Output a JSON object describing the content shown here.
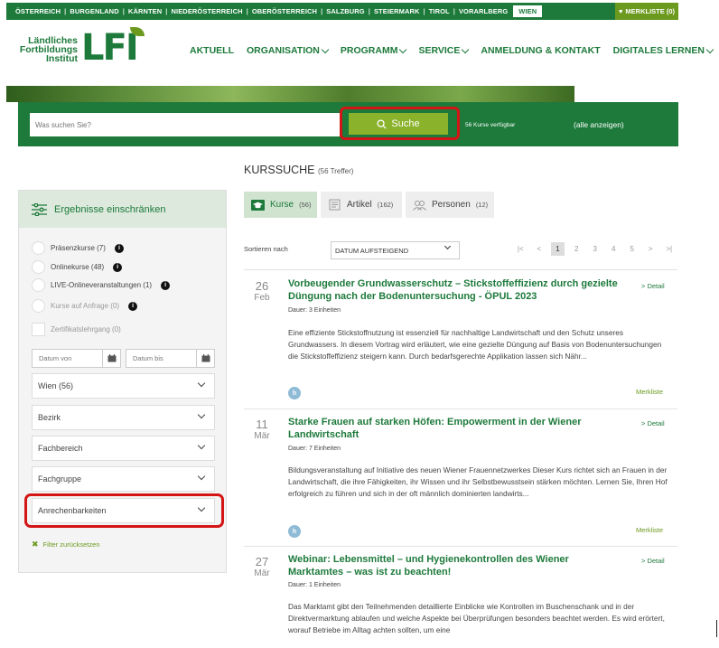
{
  "topbar": {
    "regions": [
      "ÖSTERREICH",
      "BURGENLAND",
      "KÄRNTEN",
      "NIEDERÖSTERREICH",
      "OBERÖSTERREICH",
      "SALZBURG",
      "STEIERMARK",
      "TIROL",
      "VORARLBERG"
    ],
    "active_region": "WIEN",
    "merkliste": "MERKLISTE (0)"
  },
  "logo": {
    "line1": "Ländliches",
    "line2": "Fortbildungs",
    "line3": "Institut",
    "mark": "LFI"
  },
  "nav": {
    "aktuell": "AKTUELL",
    "organisation": "ORGANISATION",
    "programm": "PROGRAMM",
    "service": "SERVICE",
    "anmeldung": "ANMELDUNG & KONTAKT",
    "digitales": "DIGITALES LERNEN"
  },
  "search": {
    "placeholder": "Was suchen Sie?",
    "button": "Suche",
    "count": "56 Kurse verfügbar",
    "show_all": "(alle anzeigen)"
  },
  "results": {
    "title": "KURSSUCHE",
    "count": "(56 Treffer)"
  },
  "sidebar": {
    "title": "Ergebnisse einschränken",
    "filters": {
      "praesenz": "Präsenzkurse (7)",
      "online": "Onlinekurse (48)",
      "live": "LIVE-Onlineveranstaltungen (1)",
      "anfrage": "Kurse auf Anfrage (0)",
      "zertifikat": "Zertifikatslehrgang (0)"
    },
    "date_from": "Datum von",
    "date_to": "Datum bis",
    "dropdowns": {
      "wien": "Wien (56)",
      "bezirk": "Bezirk",
      "fachbereich": "Fachbereich",
      "fachgruppe": "Fachgruppe",
      "anrechenbarkeiten": "Anrechenbarkeiten"
    },
    "reset": "Filter zurücksetzen"
  },
  "tabs": {
    "kurse": {
      "label": "Kurse",
      "count": "(56)"
    },
    "artikel": {
      "label": "Artikel",
      "count": "(162)"
    },
    "personen": {
      "label": "Personen",
      "count": "(12)"
    }
  },
  "sort": {
    "label": "Sortieren nach",
    "value": "DATUM AUFSTEIGEND"
  },
  "pagination": {
    "first": "|<",
    "prev": "<",
    "pages": [
      "1",
      "2",
      "3",
      "4",
      "5"
    ],
    "next": ">",
    "last": ">|"
  },
  "courses": [
    {
      "day": "26",
      "month": "Feb",
      "title": "Vorbeugender Grundwasserschutz – Stickstoffeffizienz durch gezielte Düngung nach der Bodenuntersuchung - ÖPUL 2023",
      "duration": "Dauer: 3 Einheiten",
      "description": "Eine effiziente Stickstoffnutzung ist essenziell für nachhaltige Landwirtschaft und den Schutz unseres Grundwassers. In diesem Vortrag wird erläutert, wie eine gezielte Düngung auf Basis von Bodenuntersuchungen die Stickstoffeffizienz steigern kann. Durch bedarfsgerechte Applikation lassen sich Nähr...",
      "detail": "> Detail",
      "badge": "h",
      "merkliste": "Merkliste"
    },
    {
      "day": "11",
      "month": "Mär",
      "title": "Starke Frauen auf starken Höfen: Empowerment in der Wiener Landwirtschaft",
      "duration": "Dauer: 7 Einheiten",
      "description": "Bildungsveranstaltung auf Initiative des neuen Wiener Frauennetzwerkes Dieser Kurs richtet sich an Frauen in der Landwirtschaft, die ihre Fähigkeiten, ihr Wissen und ihr Selbstbewusstsein stärken möchten. Lernen Sie, Ihren Hof erfolgreich zu führen und sich in der oft männlich dominierten landwirts...",
      "detail": "> Detail",
      "badge": "h",
      "merkliste": "Merkliste"
    },
    {
      "day": "27",
      "month": "Mär",
      "title": "Webinar: Lebensmittel – und Hygienekontrollen des Wiener Marktamtes – was ist zu beachten!",
      "duration": "Dauer: 1 Einheiten",
      "description": "Das Marktamt gibt den Teilnehmenden detaillierte Einblicke wie Kontrollen im Buschenschank und in der Direktvermarktung ablaufen und welche Aspekte bei Überprüfungen besonders beachtet werden. Es wird erörtert, worauf Betriebe im Alltag achten sollten, um eine",
      "detail": "> Detail"
    }
  ],
  "colors": {
    "brand_green": "#1d7a3b",
    "accent_green": "#8bb22b",
    "highlight_red": "#d41515"
  }
}
